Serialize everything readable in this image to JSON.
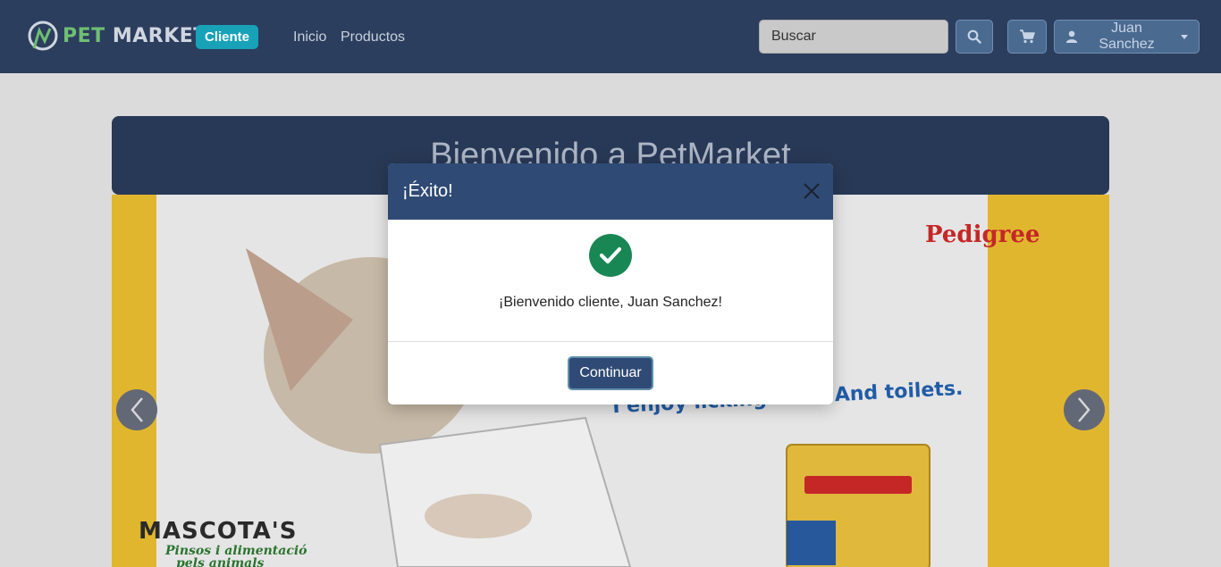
{
  "navbar": {
    "brand_pet": "PET",
    "brand_market": "MARKET",
    "role_badge": "Cliente",
    "links": [
      "Inicio",
      "Productos"
    ],
    "search_placeholder": "Buscar",
    "search_icon": "search-icon",
    "cart_icon": "cart-icon",
    "user_icon": "user-icon",
    "user_name": "Juan Sanchez"
  },
  "main": {
    "welcome_title": "Bienvenido a PetMarket"
  },
  "carousel": {
    "slide_slogan": "I enjoy licking face. And toilets.",
    "slide_brand": "Pedigree",
    "slide_store": "MASCOTA'S",
    "slide_store_sub_1": "Pinsos i alimentació",
    "slide_store_sub_2": "pels animals",
    "prev_icon": "chevron-left-icon",
    "next_icon": "chevron-right-icon"
  },
  "modal": {
    "title": "¡Éxito!",
    "message": "¡Bienvenido cliente, Juan Sanchez!",
    "button_label": "Continuar",
    "success_icon": "check-icon",
    "close_icon": "close-icon"
  },
  "colors": {
    "navbar_bg": "#2c3e5e",
    "badge": "#17a2b8",
    "success": "#198754",
    "modal_header": "#2f4a74"
  }
}
